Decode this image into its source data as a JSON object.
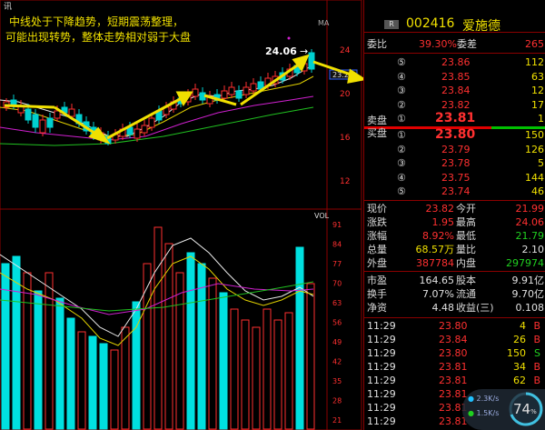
{
  "tab_fragment": "讯",
  "annotation": {
    "line1": "中线处于下降趋势，短期震荡整理，",
    "line2": "可能出现转势，整体走势相对弱于大盘"
  },
  "price_chart": {
    "ma_label": "MA",
    "high_label": "24.06",
    "high_arrow": "→",
    "current_marker": "23.21",
    "axis_labels": [
      "24",
      "20",
      "16",
      "12"
    ]
  },
  "volume_chart": {
    "vol_label": "VOL",
    "axis_labels": [
      "91",
      "84",
      "77",
      "70",
      "63",
      "56",
      "49",
      "42",
      "35",
      "28",
      "21"
    ]
  },
  "quote": {
    "badge": "R",
    "code": "002416",
    "name": "爱施德",
    "weibi_label": "委比",
    "weibi_value": "39.30%",
    "weicha_label": "委差",
    "weicha_value": "265",
    "sell_title": "卖盘",
    "buy_title": "买盘",
    "sell": [
      {
        "idx": "⑤",
        "price": "23.86",
        "vol": "112"
      },
      {
        "idx": "④",
        "price": "23.85",
        "vol": "63"
      },
      {
        "idx": "③",
        "price": "23.84",
        "vol": "12"
      },
      {
        "idx": "②",
        "price": "23.82",
        "vol": "17"
      },
      {
        "idx": "①",
        "price": "23.81",
        "vol": "1"
      }
    ],
    "buy": [
      {
        "idx": "①",
        "price": "23.80",
        "vol": "150"
      },
      {
        "idx": "②",
        "price": "23.79",
        "vol": "126"
      },
      {
        "idx": "③",
        "price": "23.78",
        "vol": "5"
      },
      {
        "idx": "④",
        "price": "23.75",
        "vol": "144"
      },
      {
        "idx": "⑤",
        "price": "23.74",
        "vol": "46"
      }
    ],
    "stats": [
      {
        "l1": "现价",
        "v1": "23.82",
        "c1": "red",
        "l2": "今开",
        "v2": "21.99",
        "c2": "red"
      },
      {
        "l1": "涨跌",
        "v1": "1.95",
        "c1": "red",
        "l2": "最高",
        "v2": "24.06",
        "c2": "red"
      },
      {
        "l1": "涨幅",
        "v1": "8.92%",
        "c1": "red",
        "l2": "最低",
        "v2": "21.79",
        "c2": "grn"
      },
      {
        "l1": "总量",
        "v1": "68.57万",
        "c1": "yel",
        "l2": "量比",
        "v2": "2.10",
        "c2": "wht"
      },
      {
        "l1": "外盘",
        "v1": "387784",
        "c1": "red",
        "l2": "内盘",
        "v2": "297974",
        "c2": "grn"
      }
    ],
    "fundamentals": [
      {
        "l1": "市盈",
        "v1": "164.65",
        "l2": "股本",
        "v2": "9.91亿"
      },
      {
        "l1": "换手",
        "v1": "7.07%",
        "l2": "流通",
        "v2": "9.70亿"
      },
      {
        "l1": "净资",
        "v1": "4.48",
        "l2": "收益(三)",
        "v2": "0.108"
      }
    ],
    "ticks": [
      {
        "time": "11:29",
        "price": "23.80",
        "vol": "4",
        "flag": "B",
        "fc": "red"
      },
      {
        "time": "11:29",
        "price": "23.84",
        "vol": "26",
        "flag": "B",
        "fc": "red"
      },
      {
        "time": "11:29",
        "price": "23.80",
        "vol": "150",
        "flag": "S",
        "fc": "grn"
      },
      {
        "time": "11:29",
        "price": "23.81",
        "vol": "34",
        "flag": "B",
        "fc": "red"
      },
      {
        "time": "11:29",
        "price": "23.81",
        "vol": "62",
        "flag": "B",
        "fc": "red"
      },
      {
        "time": "11:29",
        "price": "23.81",
        "vol": "",
        "flag": "",
        "fc": "red"
      },
      {
        "time": "11:29",
        "price": "23.81",
        "vol": "",
        "flag": "",
        "fc": "red"
      },
      {
        "time": "11:29",
        "price": "23.81",
        "vol": "",
        "flag": "",
        "fc": "red"
      }
    ]
  },
  "network": {
    "up": "2.3K/s",
    "down": "1.5K/s",
    "percent": "74",
    "percent_sign": "%"
  }
}
